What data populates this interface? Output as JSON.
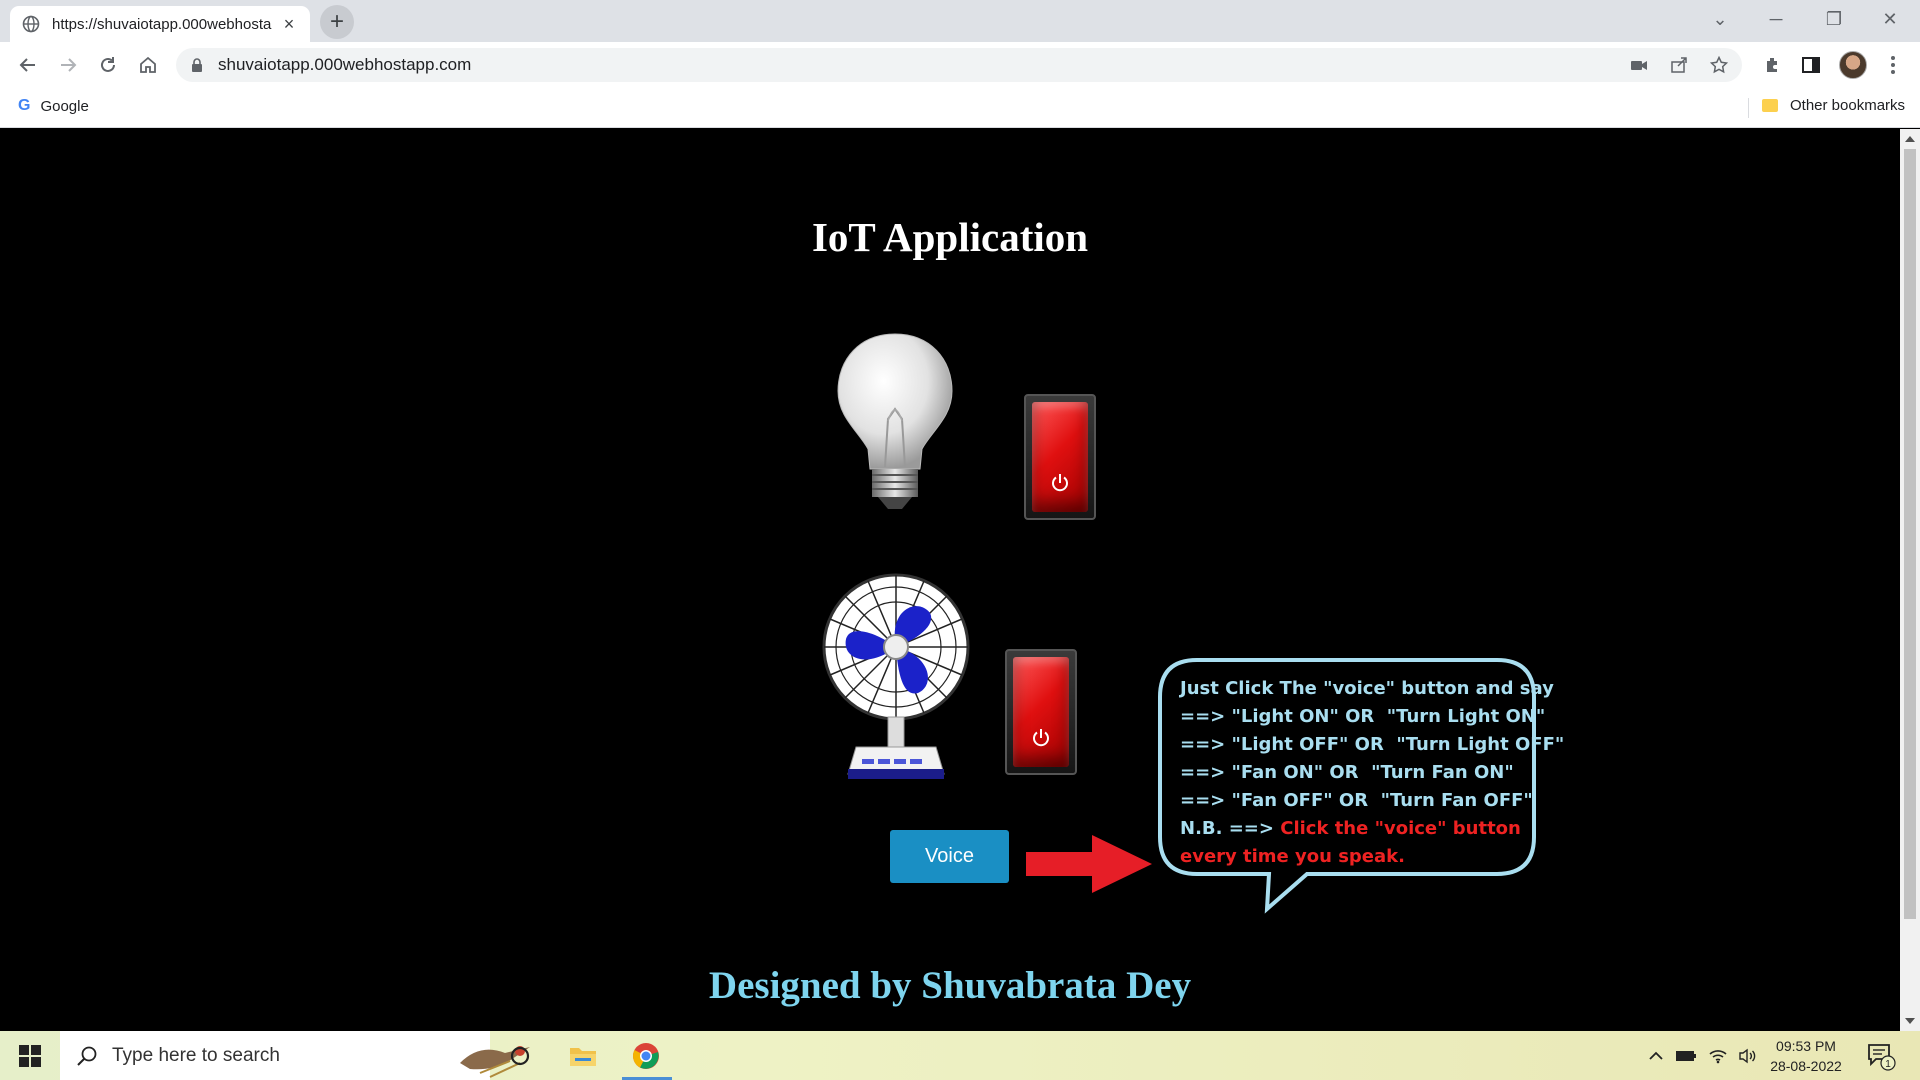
{
  "browser": {
    "tab_title": "https://shuvaiotapp.000webhosta",
    "url": "shuvaiotapp.000webhostapp.com",
    "bookmark_google": "Google",
    "bookmark_other": "Other bookmarks"
  },
  "page": {
    "title": "IoT Application",
    "voice_button": "Voice",
    "footer": "Designed by Shuvabrata Dey",
    "instructions": {
      "line1": "Just Click The \"voice\" button and say",
      "line2": "==> \"Light ON\" OR  \"Turn Light ON\"",
      "line3": "==> \"Light OFF\" OR  \"Turn Light OFF\"",
      "line4": "==> \"Fan ON\" OR  \"Turn Fan ON\"",
      "line5": "==> \"Fan OFF\" OR  \"Turn Fan OFF\"",
      "nb_prefix": "N.B. ==> ",
      "nb_red_1": "Click the \"voice\" button",
      "nb_red_2": "every time you speak."
    },
    "light_switch_state": "off",
    "fan_switch_state": "off"
  },
  "taskbar": {
    "search_placeholder": "Type here to search",
    "time": "09:53 PM",
    "date": "28-08-2022",
    "notification_count": "1"
  },
  "colors": {
    "page_background": "#000000",
    "voice_button": "#1a8fc4",
    "footer_text": "#7ed4ee",
    "bubble_text": "#a9def0",
    "note_red": "#ee2222"
  }
}
